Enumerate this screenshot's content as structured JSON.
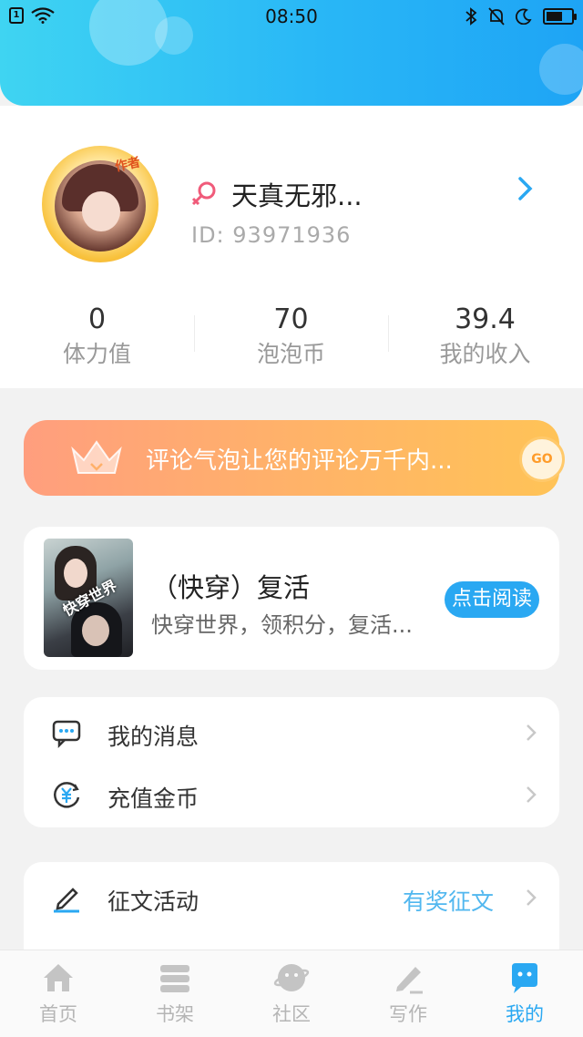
{
  "status_bar": {
    "time": "08:50",
    "sim_label": "1",
    "battery_level": 0.65
  },
  "profile": {
    "avatar_badge": "作者",
    "username": "天真无邪...",
    "user_id": "ID: 93971936",
    "gender": "female",
    "stats": [
      {
        "value": "0",
        "label": "体力值"
      },
      {
        "value": "70",
        "label": "泡泡币"
      },
      {
        "value": "39.4",
        "label": "我的收入"
      }
    ]
  },
  "promo": {
    "text": "评论气泡让您的评论万千内...",
    "go_label": "GO"
  },
  "book": {
    "cover_text": "快穿世界",
    "title": "（快穿）复活",
    "description": "快穿世界，领积分，复活...",
    "read_label": "点击阅读"
  },
  "menu_group_1": [
    {
      "label": "我的消息",
      "icon": "message-icon"
    },
    {
      "label": "充值金币",
      "icon": "coin-icon"
    }
  ],
  "menu_group_2": [
    {
      "label": "征文活动",
      "icon": "pen-icon",
      "extra": "有奖征文"
    }
  ],
  "tabbar": [
    {
      "label": "首页",
      "icon": "home-icon",
      "active": false
    },
    {
      "label": "书架",
      "icon": "bookshelf-icon",
      "active": false
    },
    {
      "label": "社区",
      "icon": "community-icon",
      "active": false
    },
    {
      "label": "写作",
      "icon": "write-icon",
      "active": false
    },
    {
      "label": "我的",
      "icon": "profile-icon",
      "active": true
    }
  ],
  "colors": {
    "accent": "#2aa8f2",
    "promo_start": "#ff9e7e",
    "promo_end": "#ffc357",
    "header": "#29b7f6"
  }
}
